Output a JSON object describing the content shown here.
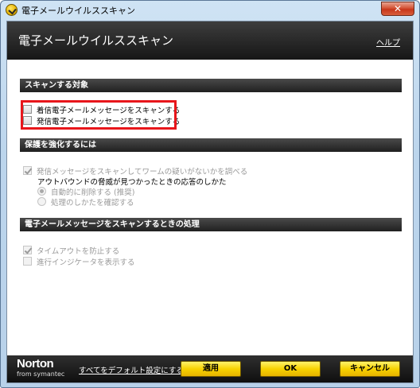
{
  "window": {
    "title": "電子メールウイルススキャン",
    "close_label": "✕"
  },
  "header": {
    "title": "電子メールウイルススキャン",
    "help": "ヘルプ"
  },
  "sections": {
    "scan_target": {
      "title": "スキャンする対象",
      "items": [
        {
          "label": "着信電子メールメッセージをスキャンする",
          "checked": false
        },
        {
          "label": "発信電子メールメッセージをスキャンする",
          "checked": false
        }
      ]
    },
    "protection": {
      "title": "保護を強化するには",
      "worm_check": "発信メッセージをスキャンしてワームの疑いがないかを調べる",
      "outbound_heading": "アウトバウンドの脅威が見つかったときの応答のしかた",
      "radio_auto": "自動的に削除する (推奨)",
      "radio_ask": "処理のしかたを確認する"
    },
    "processing": {
      "title": "電子メールメッセージをスキャンするときの処理",
      "timeout": "タイムアウトを防止する",
      "progress": "進行インジケータを表示する"
    }
  },
  "footer": {
    "logo_word": "Norton",
    "logo_sub": "from symantec",
    "defaults_link": "すべてをデフォルト設定にする",
    "apply": "適用",
    "ok": "OK",
    "cancel": "キャンセル"
  },
  "colors": {
    "highlight": "#e8161b",
    "button": "#f7d200",
    "header": "#1e1e1e"
  }
}
